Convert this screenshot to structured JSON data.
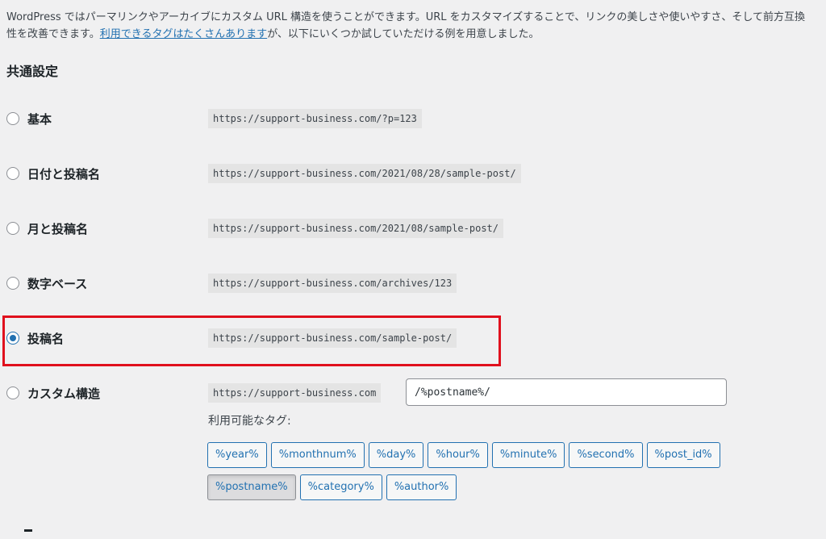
{
  "intro": {
    "text_before_link": "WordPress ではパーマリンクやアーカイブにカスタム URL 構造を使うことができます。URL をカスタマイズすることで、リンクの美しさや使いやすさ、そして前方互換性を改善できます。",
    "link_text": "利用できるタグはたくさんあります",
    "text_after_link": "が、以下にいくつか試していただける例を用意しました。"
  },
  "section_title": "共通設定",
  "options": [
    {
      "label": "基本",
      "example": "https://support-business.com/?p=123",
      "selected": false
    },
    {
      "label": "日付と投稿名",
      "example": "https://support-business.com/2021/08/28/sample-post/",
      "selected": false
    },
    {
      "label": "月と投稿名",
      "example": "https://support-business.com/2021/08/sample-post/",
      "selected": false
    },
    {
      "label": "数字ベース",
      "example": "https://support-business.com/archives/123",
      "selected": false
    },
    {
      "label": "投稿名",
      "example": "https://support-business.com/sample-post/",
      "selected": true
    }
  ],
  "custom": {
    "label": "カスタム構造",
    "base": "https://support-business.com",
    "value": "/%postname%/",
    "tags_label": "利用可能なタグ:",
    "tags_row1": [
      "%year%",
      "%monthnum%",
      "%day%",
      "%hour%",
      "%minute%",
      "%second%",
      "%post_id%"
    ],
    "tags_row2": [
      "%postname%",
      "%category%",
      "%author%"
    ],
    "active_tag": "%postname%"
  },
  "colors": {
    "accent": "#2271b1",
    "highlight_border": "#e0101d",
    "background": "#f0f0f1"
  }
}
